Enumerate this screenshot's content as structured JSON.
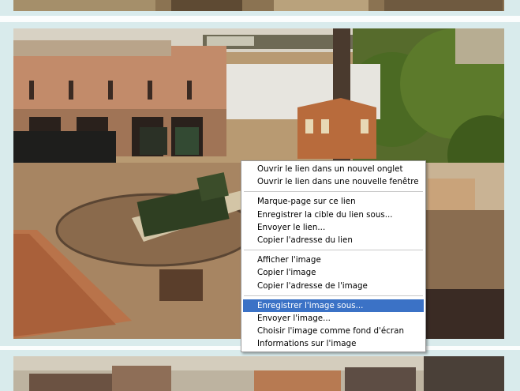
{
  "context_menu": {
    "items": [
      {
        "label": "Ouvrir le lien dans un nouvel onglet",
        "selected": false
      },
      {
        "label": "Ouvrir le lien dans une nouvelle fenêtre",
        "selected": false
      },
      {
        "separator": true
      },
      {
        "label": "Marque-page sur ce lien",
        "selected": false
      },
      {
        "label": "Enregistrer la cible du lien sous...",
        "selected": false
      },
      {
        "label": "Envoyer le lien...",
        "selected": false
      },
      {
        "label": "Copier l'adresse du lien",
        "selected": false
      },
      {
        "separator": true
      },
      {
        "label": "Afficher l'image",
        "selected": false
      },
      {
        "label": "Copier l'image",
        "selected": false
      },
      {
        "label": "Copier l'adresse de l'image",
        "selected": false
      },
      {
        "separator": true
      },
      {
        "label": "Enregistrer l'image sous...",
        "selected": true
      },
      {
        "label": "Envoyer l'image...",
        "selected": false
      },
      {
        "label": "Choisir l'image comme fond d'écran",
        "selected": false
      },
      {
        "label": "Informations sur l'image",
        "selected": false
      }
    ]
  },
  "colors": {
    "panel": "#d9ebec",
    "menu_highlight": "#3b72c6"
  }
}
